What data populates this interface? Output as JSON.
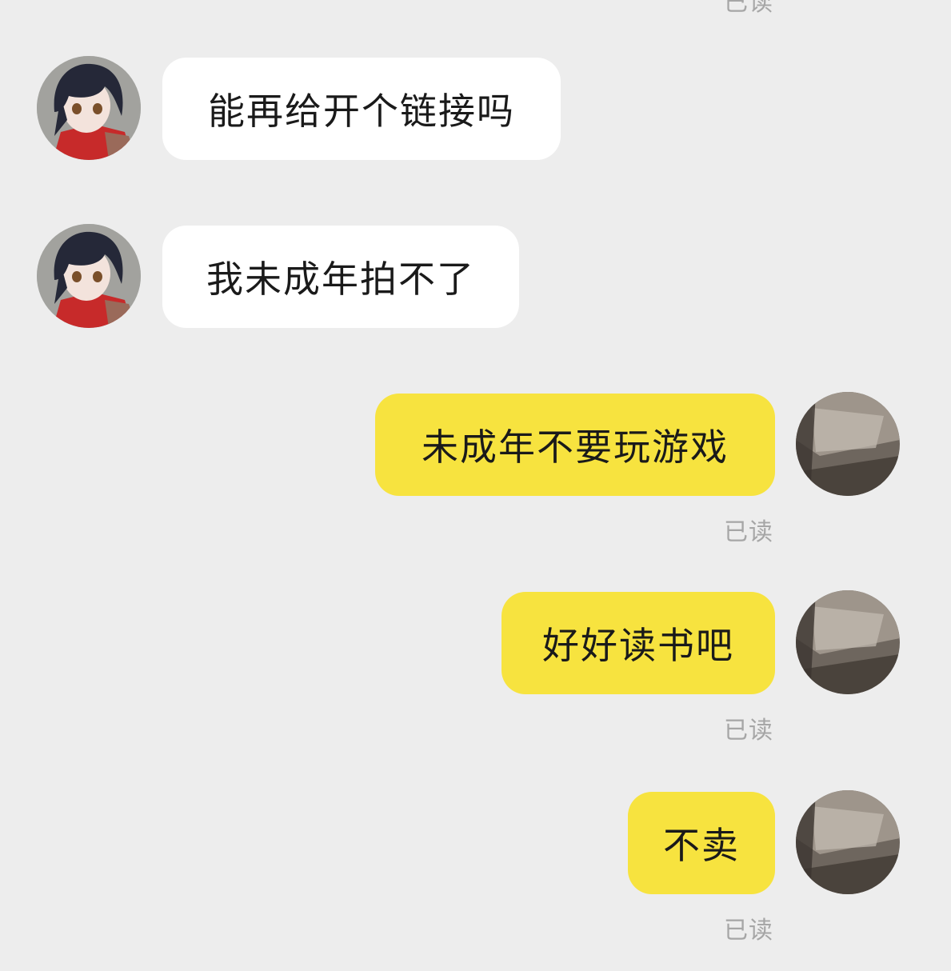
{
  "conversation": {
    "read_label": "已读",
    "messages": [
      {
        "direction": "incoming",
        "sender": "contact",
        "text": "能再给开个链接吗"
      },
      {
        "direction": "incoming",
        "sender": "contact",
        "text": "我未成年拍不了"
      },
      {
        "direction": "outgoing",
        "sender": "self",
        "text": "未成年不要玩游戏",
        "status": "已读"
      },
      {
        "direction": "outgoing",
        "sender": "self",
        "text": "好好读书吧",
        "status": "已读"
      },
      {
        "direction": "outgoing",
        "sender": "self",
        "text": "不卖",
        "status": "已读"
      }
    ]
  },
  "colors": {
    "background": "#ededed",
    "incoming_bubble": "#ffffff",
    "outgoing_bubble": "#f7e33f",
    "read_text": "#a6a6a6"
  },
  "icons": {
    "contact_avatar": "anime-girl-avatar",
    "self_avatar": "gray-photo-avatar"
  }
}
